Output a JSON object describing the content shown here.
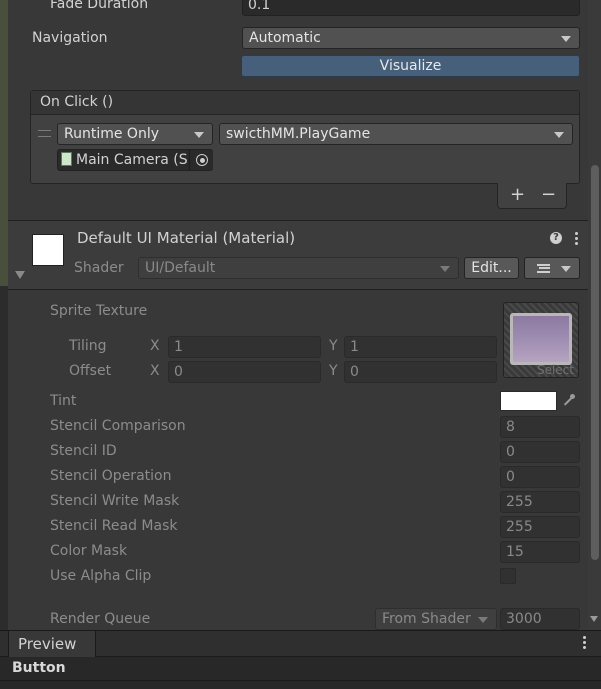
{
  "button_inspector": {
    "fade_duration": {
      "label": "Fade Duration",
      "value": "0.1"
    },
    "navigation": {
      "label": "Navigation",
      "value": "Automatic"
    },
    "visualize_label": "Visualize"
  },
  "on_click": {
    "header": "On Click ()",
    "runtime": "Runtime Only",
    "function": "swicthMM.PlayGame",
    "target_object": "Main Camera (S",
    "add_label": "+",
    "remove_label": "−"
  },
  "material": {
    "title": "Default UI Material (Material)",
    "shader_label": "Shader",
    "shader_value": "UI/Default",
    "edit_label": "Edit...",
    "sprite_texture_label": "Sprite Texture",
    "tiling_label": "Tiling",
    "offset_label": "Offset",
    "x_label": "X",
    "y_label": "Y",
    "tiling_x": "1",
    "tiling_y": "1",
    "offset_x": "0",
    "offset_y": "0",
    "select_label": "Select",
    "properties": [
      {
        "label": "Tint"
      },
      {
        "label": "Stencil Comparison",
        "value": "8"
      },
      {
        "label": "Stencil ID",
        "value": "0"
      },
      {
        "label": "Stencil Operation",
        "value": "0"
      },
      {
        "label": "Stencil Write Mask",
        "value": "255"
      },
      {
        "label": "Stencil Read Mask",
        "value": "255"
      },
      {
        "label": "Color Mask",
        "value": "15"
      },
      {
        "label": "Use Alpha Clip"
      }
    ],
    "render_queue": {
      "label": "Render Queue",
      "mode": "From Shader",
      "value": "3000"
    }
  },
  "preview": {
    "tab_label": "Preview",
    "object_name": "Button"
  },
  "colors": {
    "accent": "#46607c",
    "panel": "#383838",
    "field": "#2a2a2a"
  }
}
